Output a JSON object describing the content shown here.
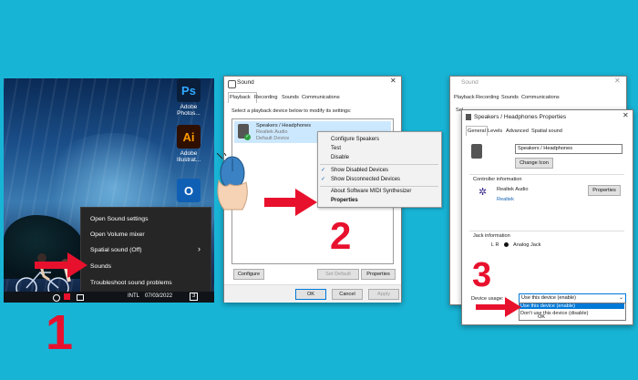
{
  "step_numbers": [
    "1",
    "2",
    "3"
  ],
  "panel1": {
    "icons": [
      {
        "glyph": "Ps",
        "label": "Adobe\nPhotos...",
        "color": "#0a1e3a"
      },
      {
        "glyph": "Ai",
        "label": "Adobe\nIllustrat...",
        "color": "#2f0f00"
      },
      {
        "glyph": "O",
        "label": "",
        "color": "#0f5fb5"
      }
    ],
    "menu": [
      "Open Sound settings",
      "Open Volume mixer",
      "Spatial sound (Off)",
      "Sounds",
      "Troubleshoot sound problems"
    ],
    "submenu_arrow": "›",
    "taskbar": {
      "lang": "INTL",
      "date": "07/03/2022",
      "notif": "3"
    }
  },
  "panel2": {
    "title": "Sound",
    "tabs": [
      "Playback",
      "Recording",
      "Sounds",
      "Communications"
    ],
    "instruction": "Select a playback device below to modify its settings:",
    "device": {
      "name": "Speakers / Headphones",
      "driver": "Realtek Audio",
      "status": "Default Device"
    },
    "context_menu": [
      "Configure Speakers",
      "Test",
      "Disable",
      "Show Disabled Devices",
      "Show Disconnected Devices",
      "About Software MIDI Synthesizer",
      "Properties"
    ],
    "buttons": {
      "configure": "Configure",
      "set_default": "Set Default",
      "properties": "Properties",
      "ok": "OK",
      "cancel": "Cancel",
      "apply": "Apply"
    }
  },
  "panel3": {
    "back_title": "Sound",
    "back_tabs": [
      "Playback",
      "Recording",
      "Sounds",
      "Communications"
    ],
    "back_partial": "Sel",
    "title": "Speakers / Headphones Properties",
    "tabs": [
      "General",
      "Levels",
      "Advanced",
      "Spatial sound"
    ],
    "name_value": "Speakers / Headphones",
    "change_icon": "Change Icon",
    "controller_label": "Controller information",
    "controller_name": "Realtek Audio",
    "controller_vendor": "Realtek",
    "properties_btn": "Properties",
    "jack_label": "Jack information",
    "jack_lr": "L R",
    "jack_value": "Analog Jack",
    "device_usage_label": "Device usage:",
    "device_usage_value": "Use this device (enable)",
    "options": [
      "Use this device (enable)",
      "Don't use this device (disable)"
    ],
    "ok": "OK"
  },
  "colors": {
    "background": "#18b4d6",
    "accent_red": "#e8112d",
    "selection_blue": "#cce8ff"
  }
}
